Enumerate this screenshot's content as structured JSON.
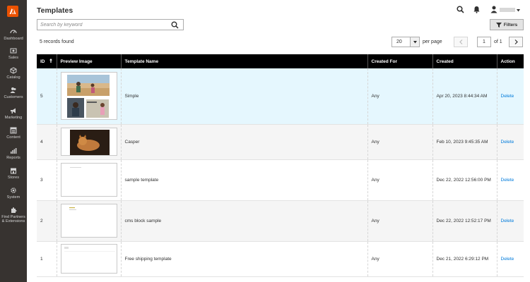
{
  "header": {
    "title": "Templates",
    "user_name": ""
  },
  "sidebar": {
    "items": [
      {
        "label": "Dashboard",
        "icon": "dashboard-icon"
      },
      {
        "label": "Sales",
        "icon": "dollar-icon"
      },
      {
        "label": "Catalog",
        "icon": "cube-icon"
      },
      {
        "label": "Customers",
        "icon": "users-icon"
      },
      {
        "label": "Marketing",
        "icon": "megaphone-icon"
      },
      {
        "label": "Content",
        "icon": "layout-icon"
      },
      {
        "label": "Reports",
        "icon": "bar-chart-icon"
      },
      {
        "label": "Stores",
        "icon": "store-icon"
      },
      {
        "label": "System",
        "icon": "gear-icon"
      },
      {
        "label": "Find Partners & Extensions",
        "icon": "puzzle-icon"
      }
    ]
  },
  "toolbar": {
    "search_placeholder": "Search by keyword",
    "filters_label": "Filters",
    "records_found": "5 records found",
    "per_page_value": "20",
    "per_page_label": "per page",
    "page_value": "1",
    "page_of": "of 1"
  },
  "table": {
    "columns": [
      "ID",
      "Preview Image",
      "Template Name",
      "Created For",
      "Created",
      "Action"
    ],
    "rows": [
      {
        "id": "5",
        "name": "Simple",
        "created_for": "Any",
        "created": "Apr 20, 2023 8:44:34 AM",
        "action": "Delete"
      },
      {
        "id": "4",
        "name": "Casper",
        "created_for": "Any",
        "created": "Feb 10, 2023 9:45:35 AM",
        "action": "Delete"
      },
      {
        "id": "3",
        "name": "sample template",
        "created_for": "Any",
        "created": "Dec 22, 2022 12:56:00 PM",
        "action": "Delete"
      },
      {
        "id": "2",
        "name": "cms block sample",
        "created_for": "Any",
        "created": "Dec 22, 2022 12:52:17 PM",
        "action": "Delete"
      },
      {
        "id": "1",
        "name": "Free shipping template",
        "created_for": "Any",
        "created": "Dec 21, 2022 6:29:12 PM",
        "action": "Delete"
      }
    ]
  },
  "colors": {
    "sidebar_bg": "#373330",
    "brand": "#eb5202",
    "link": "#007bdb",
    "row_highlight": "#e5f7fe"
  }
}
